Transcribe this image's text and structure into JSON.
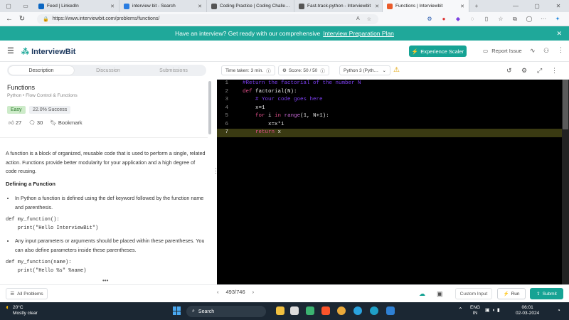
{
  "browser": {
    "tabs": [
      {
        "label": "Feed | LinkedIn",
        "active": false,
        "color": "#0a66c2"
      },
      {
        "label": "interview bit - Search",
        "active": false,
        "color": "#2a7de1"
      },
      {
        "label": "Coding Practice | Coding Challe…",
        "active": false,
        "color": "#444444"
      },
      {
        "label": "Fast-track-python - Interviewbit",
        "active": false,
        "color": "#444444"
      },
      {
        "label": "Functions | Interviewbit",
        "active": true,
        "color": "#ea5b2a"
      }
    ],
    "url": "https://www.interviewbit.com/problems/functions/"
  },
  "banner": {
    "text": "Have an interview? Get ready with our comprehensive",
    "link": "Interview Preparation Plan"
  },
  "header": {
    "logo": "InterviewBit",
    "experience_button": "Experience Scaler",
    "report_issue": "Report Issue"
  },
  "problem": {
    "tabs": [
      "Description",
      "Discussion",
      "Submissions"
    ],
    "title": "Functions",
    "breadcrumb": "Python • Flow Control & Functions",
    "difficulty": "Easy",
    "success": "22.0% Success",
    "likes": "27",
    "comments": "30",
    "bookmark": "Bookmark",
    "intro": "A function is a block of organized, reusable code that is used to perform a single, related action. Functions provide better modularity for your application and a high degree of code reusing.",
    "section_heading": "Defining a Function",
    "bullet1": "In Python a function is defined using the def keyword followed by the function name and parenthesis.",
    "code1": "def my_function():\n    print(\"Hello InterviewBit\")",
    "bullet2": "Any input parameters or arguments should be placed within these parentheses. You can also define parameters inside these parentheses.",
    "code2": "def my_function(name):\n    print(\"Hello %s\" %name)"
  },
  "editor": {
    "time_taken": "Time taken: 3 min.",
    "score": "Score: 50 / 50",
    "language": "Python 3 (Pyth…",
    "line_numbers": [
      "1",
      "2",
      "3",
      "4",
      "5",
      "6",
      "7"
    ],
    "code_lines": [
      {
        "indent": "",
        "parts": [
          {
            "t": "#Return the factorial of the number N",
            "c": "cm"
          }
        ]
      },
      {
        "indent": "",
        "parts": [
          {
            "t": "def ",
            "c": "kw"
          },
          {
            "t": "factorial(N):",
            "c": "fn"
          }
        ]
      },
      {
        "indent": "    ",
        "parts": [
          {
            "t": "# Your code goes here",
            "c": "cm"
          }
        ]
      },
      {
        "indent": "    ",
        "parts": [
          {
            "t": "x=1",
            "c": "fn"
          }
        ]
      },
      {
        "indent": "    ",
        "parts": [
          {
            "t": "for ",
            "c": "kw"
          },
          {
            "t": "i ",
            "c": "fn"
          },
          {
            "t": "in ",
            "c": "kw"
          },
          {
            "t": "range",
            "c": "bi"
          },
          {
            "t": "(1, N+1):",
            "c": "fn"
          }
        ]
      },
      {
        "indent": "        ",
        "parts": [
          {
            "t": "x=x*i",
            "c": "fn"
          }
        ]
      },
      {
        "indent": "    ",
        "parts": [
          {
            "t": "return ",
            "c": "kw"
          },
          {
            "t": "x",
            "c": "fn"
          }
        ]
      }
    ],
    "highlighted_line": 7
  },
  "bottom": {
    "all_problems": "All Problems",
    "pager": "493/746",
    "custom_input": "Custom Input",
    "run": "Run",
    "submit": "Submit"
  },
  "taskbar": {
    "temperature": "20°C",
    "weather": "Mostly clear",
    "search": "Search",
    "lang1": "ENG",
    "lang2": "IN",
    "time": "06:01",
    "date": "02-03-2024"
  },
  "colors": {
    "accent": "#16a394",
    "banner": "#1fa89a"
  }
}
